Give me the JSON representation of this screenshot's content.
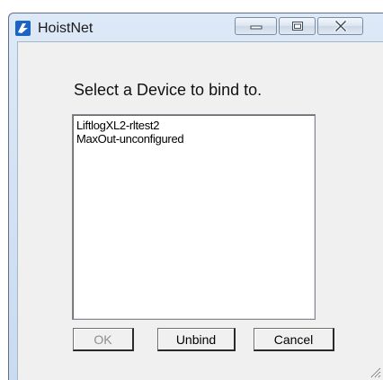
{
  "window": {
    "title": "HoistNet",
    "icon": "hoistnet-app-icon",
    "caption_buttons": [
      "minimize-icon",
      "maximize-icon",
      "close-icon"
    ]
  },
  "dialog": {
    "prompt": "Select a Device to bind to.",
    "devices": [
      "LiftlogXL2-rltest2",
      "MaxOut-unconfigured"
    ],
    "buttons": {
      "ok": "OK",
      "ok_enabled": false,
      "unbind": "Unbind",
      "cancel": "Cancel"
    }
  },
  "colors": {
    "accent": "#1f6fd1",
    "client_background": "#f0f0f0",
    "disabled_text": "#8d8d8d"
  }
}
